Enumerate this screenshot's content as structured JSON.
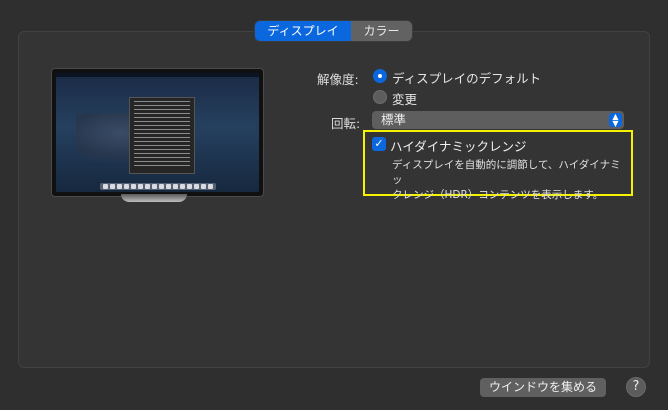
{
  "tabs": [
    {
      "label": "ディスプレイ",
      "active": true
    },
    {
      "label": "カラー",
      "active": false
    }
  ],
  "resolution": {
    "label": "解像度:",
    "options": [
      {
        "label": "ディスプレイのデフォルト",
        "selected": true
      },
      {
        "label": "変更",
        "selected": false
      }
    ]
  },
  "rotation": {
    "label": "回転:",
    "value": "標準"
  },
  "hdr": {
    "label": "ハイダイナミックレンジ",
    "checked": true,
    "desc_line1": "ディスプレイを自動的に調節して、ハイダイナミッ",
    "desc_line2": "クレンジ（HDR）コンテンツを表示します。"
  },
  "footer": {
    "gather_windows": "ウインドウを集める",
    "help": "?"
  },
  "colors": {
    "accent": "#0a67dd",
    "highlight": "#f5f200"
  }
}
